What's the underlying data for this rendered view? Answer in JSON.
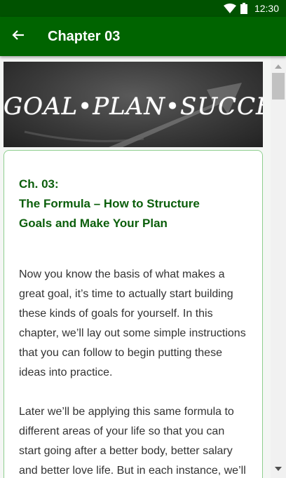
{
  "status_bar": {
    "time": "12:30",
    "icons": [
      "wifi-icon",
      "battery-icon"
    ]
  },
  "app_bar": {
    "title": "Chapter 03",
    "back_icon": "arrow-back-icon"
  },
  "banner": {
    "text": "GOAL•PLAN•SUCCESS"
  },
  "chapter": {
    "heading_lines": [
      "Ch. 03:",
      "The Formula – How to Structure",
      "Goals and Make Your Plan"
    ],
    "paragraph1_lines": [
      "Now you know the basis of what makes a",
      "great goal, it’s time to actually start building",
      "these kinds of goals for yourself. In this",
      "chapter, we’ll lay out some simple instructions",
      "that you can follow to begin putting these",
      "ideas into practice."
    ],
    "paragraph2_lines": [
      "Later we’ll be applying this same formula to",
      "different areas of your life so that you can",
      "start going after a better body, better salary",
      "and better love life. But in each instance, we’ll"
    ]
  },
  "colors": {
    "status_bar": "#005200",
    "app_bar": "#006400",
    "heading": "#0b5e0b",
    "card_border": "#8fcf8f"
  }
}
